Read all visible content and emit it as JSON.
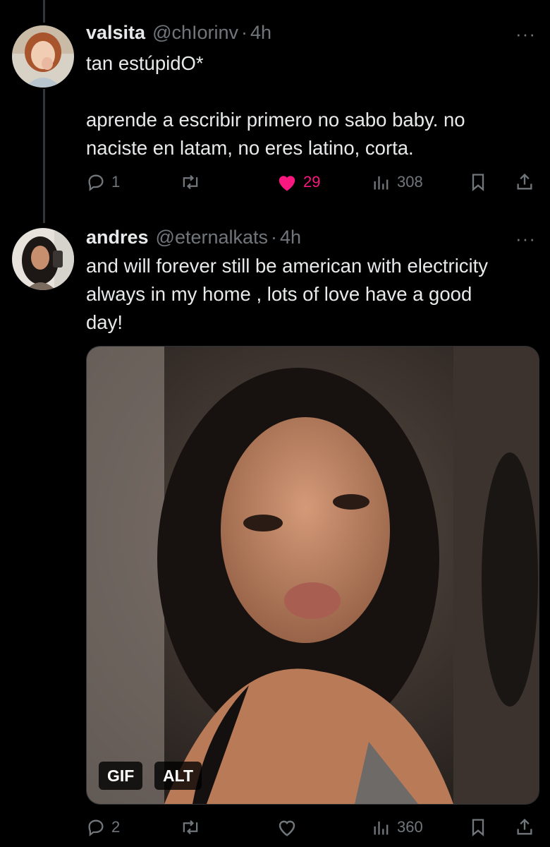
{
  "tweets": [
    {
      "name": "valsita",
      "handle": "@chIorinv",
      "dot": "·",
      "time": "4h",
      "more": "···",
      "text": "tan estúpidO*\n\naprende a escribir primero no sabo baby. no naciste en latam, no eres latino, corta.",
      "replies": "1",
      "retweets": "",
      "likes": "29",
      "views": "308",
      "liked": true
    },
    {
      "name": "andres",
      "handle": "@eternalkats",
      "dot": "·",
      "time": "4h",
      "more": "···",
      "text": "and will forever still be american with electricity always in my home , lots of love have a good day!",
      "replies": "2",
      "retweets": "",
      "likes": "",
      "views": "360",
      "liked": false,
      "media": {
        "gif_badge": "GIF",
        "alt_badge": "ALT"
      }
    }
  ],
  "colors": {
    "like_active": "#f91880",
    "muted": "#71767b",
    "text": "#e7e9ea",
    "background": "#000000"
  }
}
